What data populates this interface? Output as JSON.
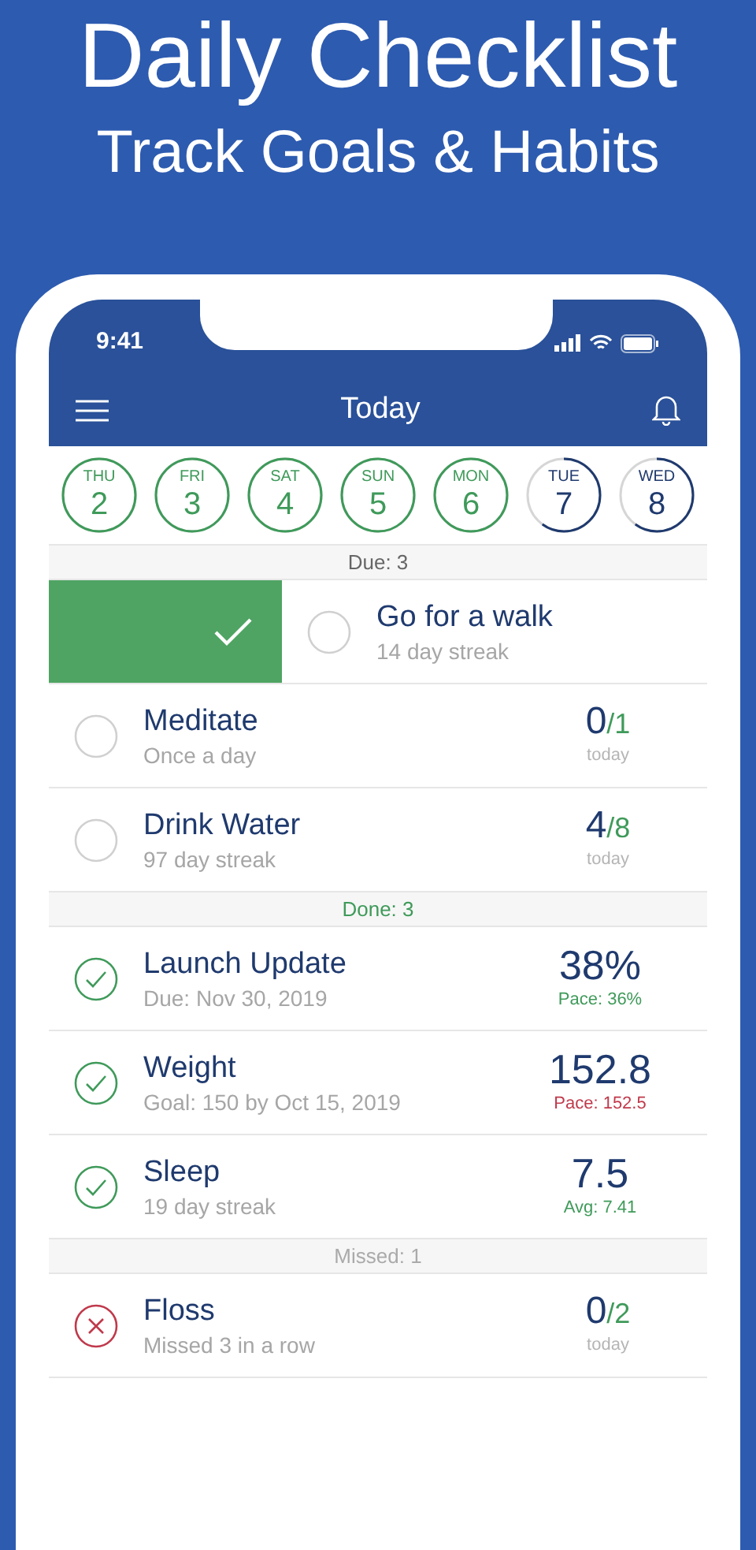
{
  "headline": {
    "title": "Daily Checklist",
    "subtitle": "Track Goals & Habits"
  },
  "status_bar": {
    "time": "9:41"
  },
  "nav": {
    "title": "Today"
  },
  "days": [
    {
      "weekday": "THU",
      "date": "2",
      "complete": true
    },
    {
      "weekday": "FRI",
      "date": "3",
      "complete": true
    },
    {
      "weekday": "SAT",
      "date": "4",
      "complete": true
    },
    {
      "weekday": "SUN",
      "date": "5",
      "complete": true
    },
    {
      "weekday": "MON",
      "date": "6",
      "complete": true
    },
    {
      "weekday": "TUE",
      "date": "7",
      "complete": false
    },
    {
      "weekday": "WED",
      "date": "8",
      "complete": false
    }
  ],
  "sections": [
    {
      "label": "Due: 3",
      "color": "#666666",
      "items": [
        {
          "title": "Go for a walk",
          "subtitle": "14 day streak",
          "checked": false,
          "missed": false,
          "swiped": true
        },
        {
          "title": "Meditate",
          "subtitle": "Once a day",
          "checked": false,
          "missed": false,
          "swiped": false,
          "kind": "count",
          "value": "0",
          "target": "/1",
          "note": "today"
        },
        {
          "title": "Drink Water",
          "subtitle": "97 day streak",
          "checked": false,
          "missed": false,
          "swiped": false,
          "kind": "count",
          "value": "4",
          "target": "/8",
          "note": "today"
        }
      ]
    },
    {
      "label": "Done: 3",
      "color": "#3f9a5a",
      "items": [
        {
          "title": "Launch Update",
          "subtitle": "Due: Nov 30, 2019",
          "checked": true,
          "missed": false,
          "swiped": false,
          "kind": "metric",
          "value": "38%",
          "note": "Pace: 36%",
          "color": "#3f9a5a"
        },
        {
          "title": "Weight",
          "subtitle": "Goal: 150 by Oct 15, 2019",
          "checked": true,
          "missed": false,
          "swiped": false,
          "kind": "metric",
          "value": "152.8",
          "note": "Pace: 152.5",
          "color": "#c0394b"
        },
        {
          "title": "Sleep",
          "subtitle": "19 day streak",
          "checked": true,
          "missed": false,
          "swiped": false,
          "kind": "metric",
          "value": "7.5",
          "note": "Avg: 7.41",
          "color": "#3f9a5a"
        }
      ]
    },
    {
      "label": "Missed: 1",
      "color": "#aaaaaa",
      "items": [
        {
          "title": "Floss",
          "subtitle": "Missed 3 in a row",
          "checked": false,
          "missed": true,
          "swiped": false,
          "kind": "count",
          "value": "0",
          "target": "/2",
          "note": "today"
        }
      ]
    }
  ]
}
